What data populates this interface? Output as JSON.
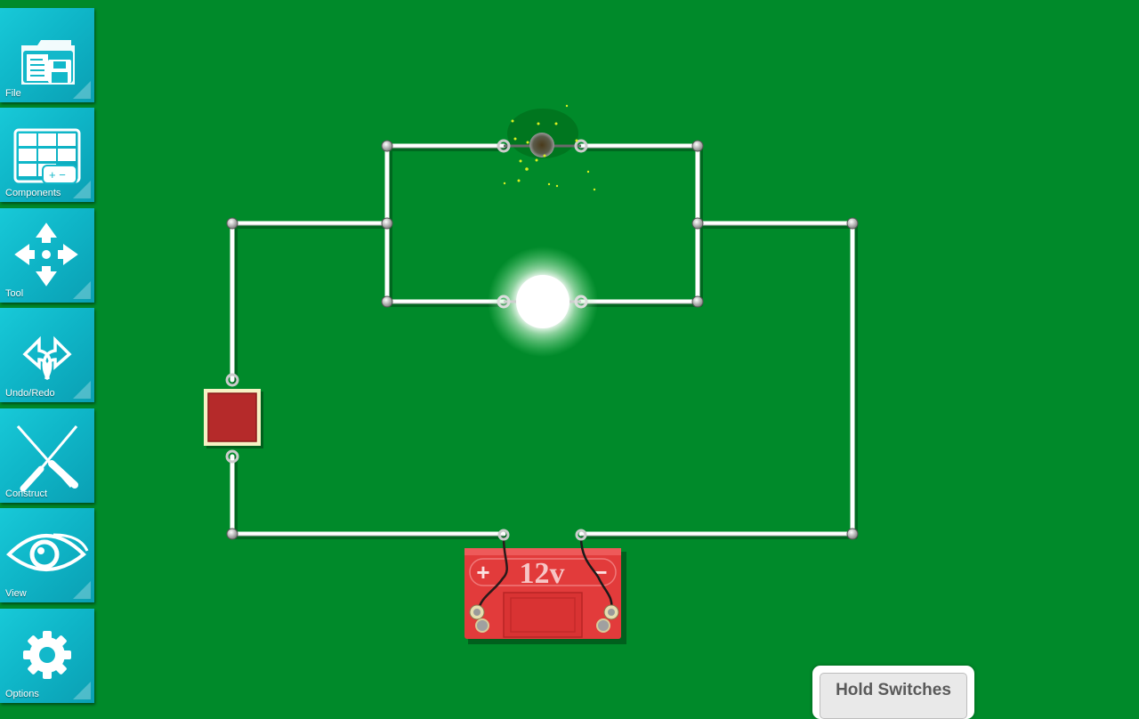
{
  "sidebar": {
    "items": [
      {
        "label": "File",
        "icon": "folder-floppy-icon"
      },
      {
        "label": "Components",
        "icon": "components-battery-icon"
      },
      {
        "label": "Tool",
        "icon": "move-arrows-icon"
      },
      {
        "label": "Undo/Redo",
        "icon": "undo-redo-icon"
      },
      {
        "label": "Construct",
        "icon": "screwdriver-tools-icon"
      },
      {
        "label": "View",
        "icon": "eye-icon"
      },
      {
        "label": "Options",
        "icon": "gear-icon"
      }
    ]
  },
  "circuit": {
    "battery": {
      "label": "12v",
      "plus": "+",
      "minus": "−",
      "color": "#e23b3b"
    },
    "bulb_lit": {
      "state": "on"
    },
    "bulb_burnt": {
      "state": "blown"
    },
    "switch": {
      "state": "closed",
      "color": "#b52a2a"
    }
  },
  "colors": {
    "background": "#008a2a",
    "button": "#12bccd"
  },
  "hold_switches": {
    "label": "Hold Switches"
  }
}
